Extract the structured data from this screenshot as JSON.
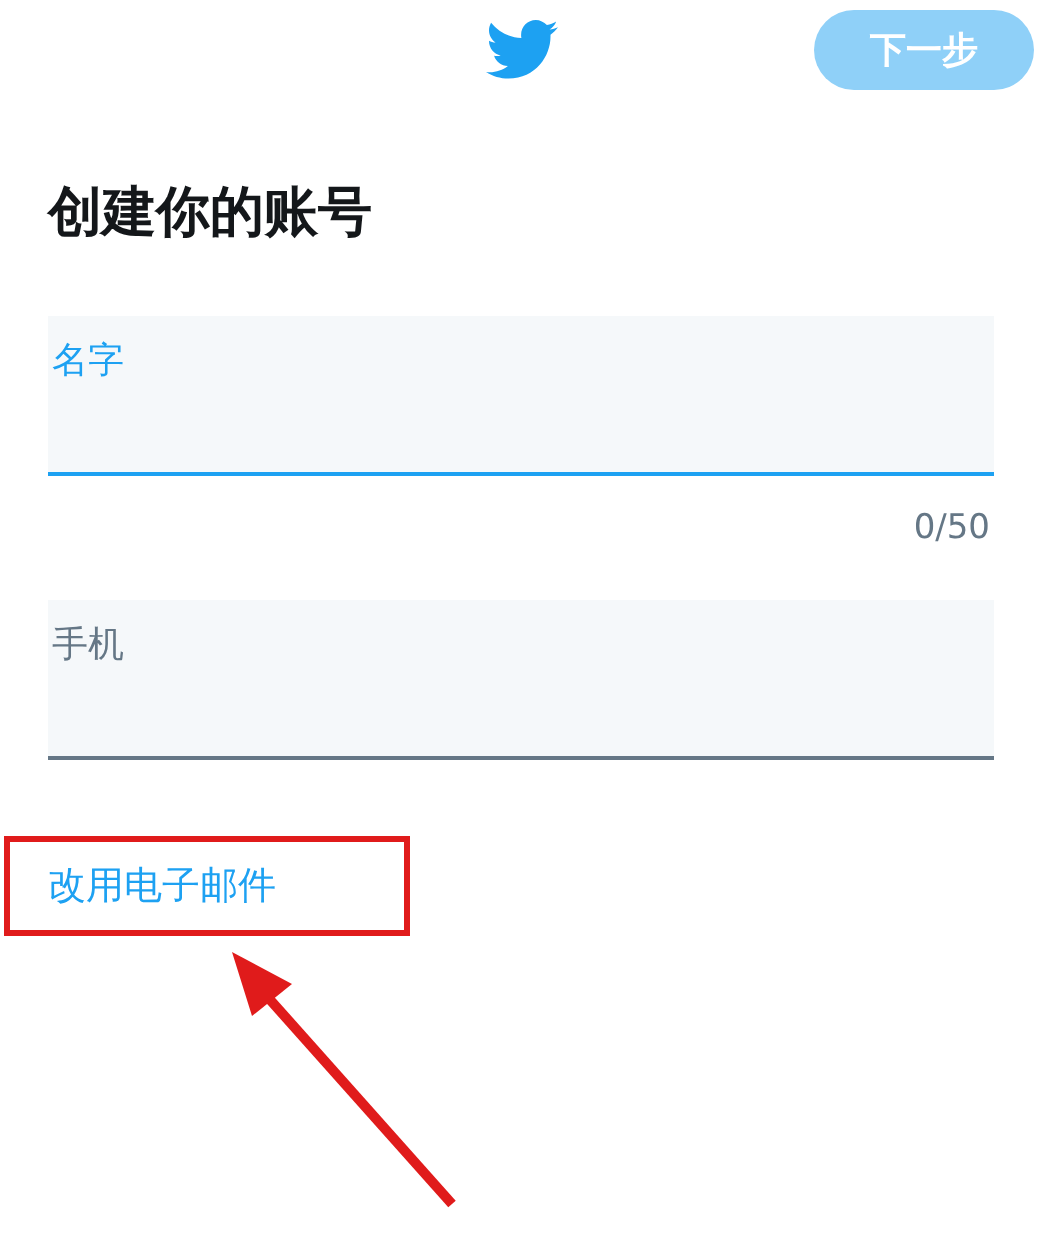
{
  "header": {
    "next_button": {
      "label": "下一步",
      "disabled": true
    }
  },
  "title": "创建你的账号",
  "fields": [
    {
      "placeholder": "名字",
      "focused": true,
      "counter": "0/50"
    },
    {
      "placeholder": "手机",
      "focused": false
    }
  ],
  "alt_link": "改用电子邮件",
  "annotation": {
    "highlight_box": true,
    "arrow": true
  }
}
